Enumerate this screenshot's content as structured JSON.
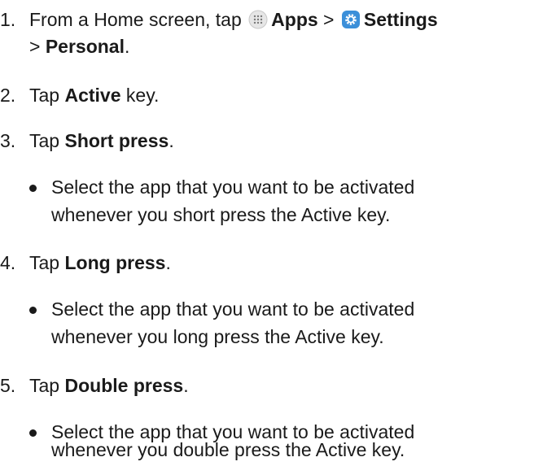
{
  "steps": [
    {
      "number": "1.",
      "prefix": "From a Home screen, tap",
      "apps_label": "Apps",
      "sep1": ">",
      "settings_label": "Settings",
      "sep2": ">",
      "personal_label": "Personal",
      "end": "."
    },
    {
      "number": "2.",
      "prefix": "Tap",
      "bold": "Active",
      "suffix": "key."
    },
    {
      "number": "3.",
      "prefix": "Tap",
      "bold": "Short press",
      "suffix": ".",
      "bullet_line1": "Select the app that you want to be activated",
      "bullet_line2": "whenever you short press the Active key."
    },
    {
      "number": "4.",
      "prefix": "Tap",
      "bold": "Long press",
      "suffix": ".",
      "bullet_line1": "Select the app that you want to be activated",
      "bullet_line2": "whenever you long press the Active key."
    },
    {
      "number": "5.",
      "prefix": "Tap",
      "bold": "Double press",
      "suffix": ".",
      "bullet_line1": "Select the app that you want to be activated",
      "bullet_line2": "whenever you double press the Active key."
    }
  ],
  "icons": {
    "apps": "apps-grid-icon",
    "settings": "settings-gear-icon",
    "settings_color": "#3b8fd9"
  }
}
